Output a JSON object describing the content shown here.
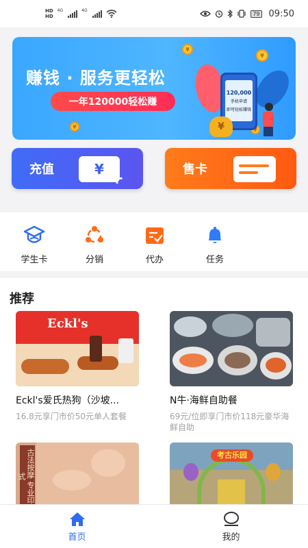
{
  "status_bar": {
    "hd1": "HD",
    "hd2": "HD",
    "net1": "4G",
    "net2": "4G",
    "battery": "79",
    "time": "09:50"
  },
  "banner": {
    "headline": "赚钱 · 服务更轻松",
    "pill": "一年120000轻松赚",
    "phone_amount": "120,000",
    "phone_line1": "手机申请",
    "phone_line2": "即可轻松赚钱"
  },
  "actions": {
    "recharge_label": "充值",
    "recharge_symbol": "¥",
    "sellcard_label": "售卡"
  },
  "quick_menu": [
    {
      "label": "学生卡",
      "icon": "graduation-cap-icon"
    },
    {
      "label": "分销",
      "icon": "share-nodes-icon"
    },
    {
      "label": "代办",
      "icon": "task-check-icon"
    },
    {
      "label": "任务",
      "icon": "bell-icon"
    }
  ],
  "recommend": {
    "title": "推荐",
    "items": [
      {
        "name": "Eckl's爱氏热狗（沙坡...",
        "desc": "16.8元享门市价50元单人套餐",
        "img_text": "Eckl's"
      },
      {
        "name": "N牛·海鲜自助餐",
        "desc": "69元/位即享门市价118元豪华海鲜自助",
        "img_text": ""
      },
      {
        "name": "",
        "desc": "",
        "img_text": "古法按摩 专业印式"
      },
      {
        "name": "",
        "desc": "",
        "img_text": "考古乐园"
      }
    ]
  },
  "tabbar": {
    "home": "首页",
    "mine": "我的"
  },
  "colors": {
    "primary_blue": "#2f6cf0",
    "orange": "#ff6a16",
    "red": "#ff3048"
  }
}
